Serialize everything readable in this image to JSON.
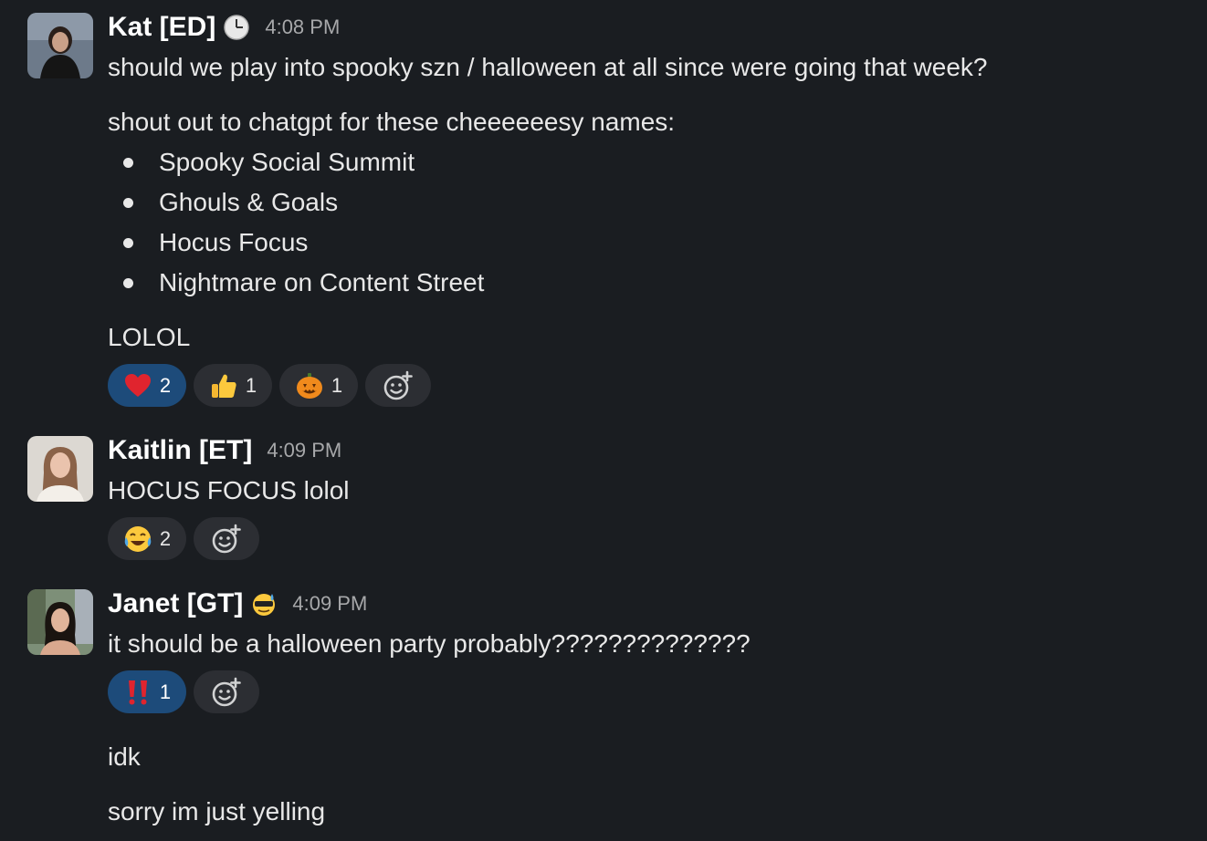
{
  "messages": [
    {
      "author": "Kat [ED]",
      "status_icon": "clock-icon",
      "time": "4:08 PM",
      "text": "should we play into spooky szn / halloween at all since were going that week?",
      "intro": "shout out to chatgpt for these cheeeeeesy names:",
      "bullets": [
        "Spooky Social Summit",
        "Ghouls & Goals",
        "Hocus Focus",
        "Nightmare on Content Street"
      ],
      "followup": "LOLOL",
      "reactions": [
        {
          "emoji": "red-heart",
          "count": "2",
          "active": true
        },
        {
          "emoji": "thumbs-up",
          "count": "1",
          "active": false
        },
        {
          "emoji": "jack-o-lantern",
          "count": "1",
          "active": false
        }
      ]
    },
    {
      "author": "Kaitlin [ET]",
      "time": "4:09 PM",
      "text": "HOCUS FOCUS lolol",
      "reactions": [
        {
          "emoji": "crying-laughing",
          "count": "2",
          "active": false
        }
      ]
    },
    {
      "author": "Janet [GT]",
      "status_icon": "sunglasses-sweat-icon",
      "time": "4:09 PM",
      "text": "it should be a halloween party probably??????????????",
      "reactions": [
        {
          "emoji": "double-exclamation",
          "count": "1",
          "active": true
        }
      ],
      "followups": [
        "idk",
        "sorry im just yelling"
      ]
    }
  ],
  "colors": {
    "background": "#1a1d21",
    "reaction_bg": "#2c2e33",
    "reaction_active_bg": "#1d4b7a"
  }
}
